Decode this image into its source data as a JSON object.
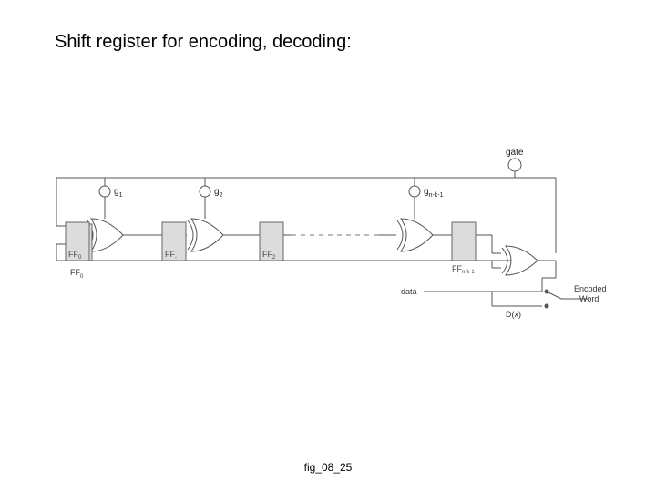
{
  "title": "Shift register for encoding, decoding:",
  "footer": "fig_08_25",
  "labels": {
    "gate": "gate",
    "data": "data",
    "dx": "D(x)",
    "output1": "Encoded",
    "output2": "Word",
    "g1": "g",
    "g1sub": "1",
    "g2": "g",
    "g2sub": "2",
    "g3": "g",
    "g3sub": "n-k-1",
    "ff0": "FF",
    "ff0sub": "0",
    "ff1": "FF",
    "ff1sub": "-",
    "ff2": "FF",
    "ff2sub": "2",
    "ff3": "FF",
    "ff3sub": "n-k-1"
  }
}
